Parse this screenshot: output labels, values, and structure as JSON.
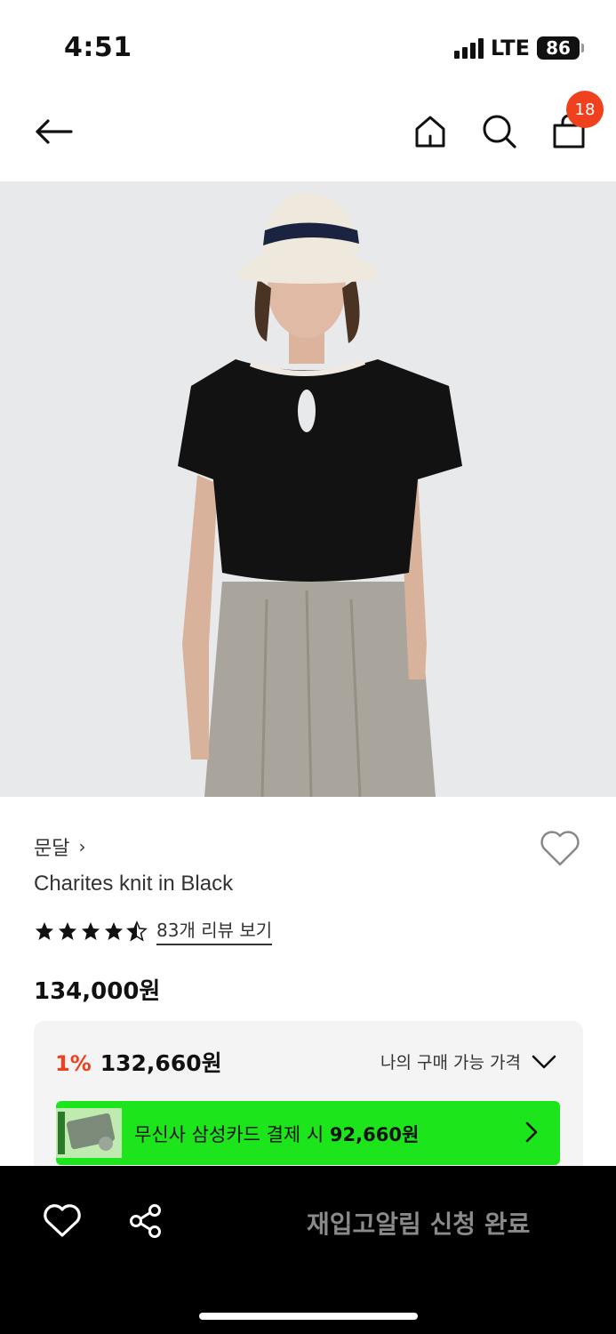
{
  "status_bar": {
    "time": "4:51",
    "network": "LTE",
    "battery": "86"
  },
  "nav": {
    "back_icon": "arrow-left-icon",
    "home_icon": "home-icon",
    "search_icon": "search-icon",
    "cart_icon": "shopping-bag-icon",
    "cart_count": "18"
  },
  "product": {
    "image_alt": "model-in-black-knit-top-icon",
    "brand": "문달",
    "brand_chevron": "›",
    "name": "Charites knit in Black",
    "rating": 4.5,
    "review_link": "83개 리뷰 보기",
    "price": "134,000원"
  },
  "price_box": {
    "discount_rate": "1%",
    "discount_price": "132,660원",
    "my_price_label": "나의 구매 가능 가격"
  },
  "promo": {
    "text_prefix": "무신사 삼성카드 결제 시 ",
    "text_amount": "92,660원"
  },
  "bottom_bar": {
    "cta_label": "재입고알림 신청 완료"
  },
  "colors": {
    "accent": "#f0411e",
    "promo_green": "#1ce51c",
    "bottom_bar": "#000000"
  }
}
